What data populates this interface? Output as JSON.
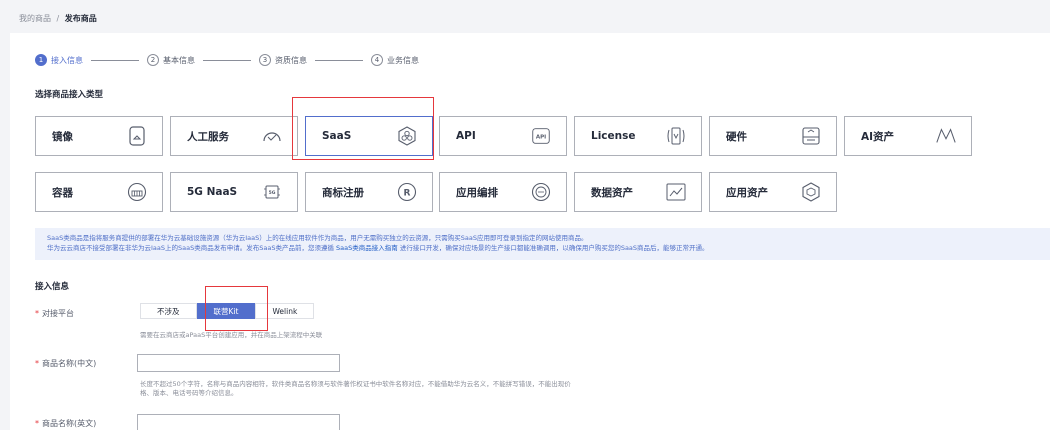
{
  "breadcrumb": {
    "parent": "我的商品",
    "separator": "/",
    "current": "发布商品"
  },
  "steps": [
    {
      "num": "1",
      "label": "接入信息"
    },
    {
      "num": "2",
      "label": "基本信息"
    },
    {
      "num": "3",
      "label": "资质信息"
    },
    {
      "num": "4",
      "label": "业务信息"
    }
  ],
  "product_type": {
    "title": "选择商品接入类型",
    "row1": [
      {
        "label": "镜像",
        "icon": "image-icon"
      },
      {
        "label": "人工服务",
        "icon": "service-icon"
      },
      {
        "label": "SaaS",
        "icon": "saas-icon",
        "selected": true
      },
      {
        "label": "API",
        "icon": "api-icon"
      },
      {
        "label": "License",
        "icon": "license-icon"
      },
      {
        "label": "硬件",
        "icon": "hardware-icon"
      },
      {
        "label": "AI资产",
        "icon": "ai-asset-icon"
      }
    ],
    "row2": [
      {
        "label": "容器",
        "icon": "container-icon"
      },
      {
        "label": "5G NaaS",
        "icon": "5g-icon"
      },
      {
        "label": "商标注册",
        "icon": "trademark-icon"
      },
      {
        "label": "应用编排",
        "icon": "orchestration-icon"
      },
      {
        "label": "数据资产",
        "icon": "data-asset-icon"
      },
      {
        "label": "应用资产",
        "icon": "app-asset-icon"
      }
    ]
  },
  "notice": {
    "line1": "SaaS类商品是指将服务商提供的部署在华为云基础设施资源（华为云IaaS）上的在线应用软件作为商品，用户无需购买独立的云资源，只需购买SaaS应用即可登录到指定的网站使用商品。",
    "line2_a": "华为云云商店不接受部署在非华为云IaaS上的SaaS类商品发布申请。发布SaaS类产品前，您须遵循",
    "line2_link": "SaaS类商品接入指南",
    "line2_b": "进行接口开发，确保对应场景的生产接口都能准确调用，以确保用户购买您的SaaS商品后，能够正常开通。"
  },
  "access": {
    "title": "接入信息",
    "platform_label": "对接平台",
    "platform_options": [
      "不涉及",
      "联营Kit",
      "Welink"
    ],
    "platform_selected": "联营Kit",
    "platform_hint": "需要在云商店或aPaaS平台创建应用，并在商品上架流程中关联",
    "name_cn_label": "商品名称(中文)",
    "name_cn_value": "",
    "name_cn_hint1": "长度不超过50个字符，名称与商品内容相符，软件类商品名称须与软件著作权证书中软件名称对应，不能借助华为云名义，不能拼写错误，不能出现价",
    "name_cn_hint2": "格、版本、电话号码等介绍信息。",
    "name_en_label": "商品名称(英文)",
    "name_en_value": ""
  },
  "required_mark": "*",
  "colors": {
    "accent": "#526ecc",
    "highlight": "#e5383d",
    "notice_bg": "#edf1fb"
  }
}
